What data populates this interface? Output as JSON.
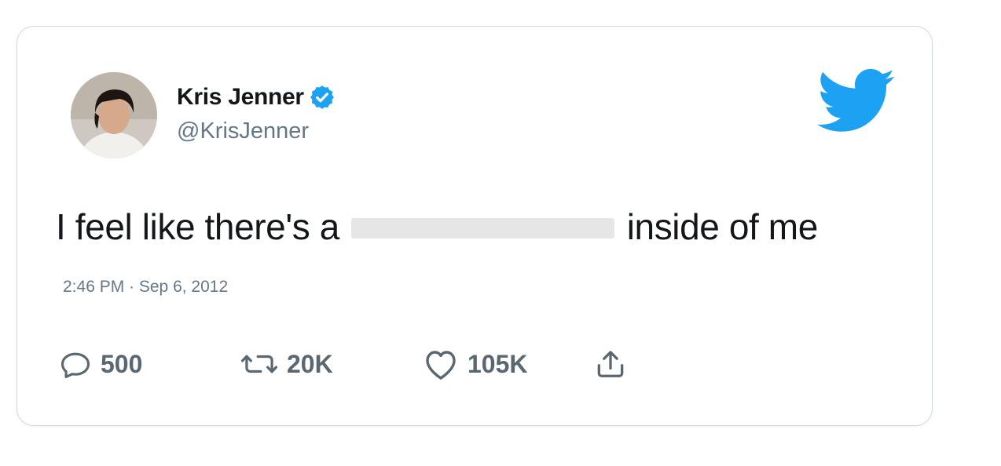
{
  "user": {
    "display_name": "Kris Jenner",
    "handle": "@KrisJenner",
    "verified": true
  },
  "tweet": {
    "text_before": "I feel like there's a",
    "text_after": "inside of me",
    "timestamp": "2:46 PM · Sep 6, 2012"
  },
  "actions": {
    "replies": "500",
    "retweets": "20K",
    "likes": "105K"
  },
  "icons": {
    "brand": "twitter-bird-icon",
    "verified": "verified-badge-icon",
    "reply": "reply-icon",
    "retweet": "retweet-icon",
    "like": "heart-icon",
    "share": "share-icon"
  },
  "colors": {
    "twitter_blue": "#1da1f2",
    "icon_gray": "#5b6770",
    "text": "#14171a",
    "muted": "#657786"
  }
}
